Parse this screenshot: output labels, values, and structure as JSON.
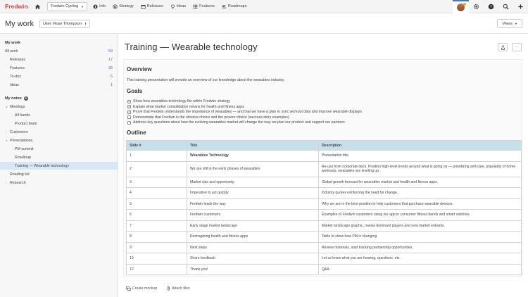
{
  "app": {
    "logo": "Fredwin"
  },
  "topnav": {
    "workspace": "Fredwin Cycling",
    "tabs": [
      {
        "label": "Info",
        "icon": "info-icon"
      },
      {
        "label": "Strategy",
        "icon": "strategy-icon"
      },
      {
        "label": "Releases",
        "icon": "calendar-icon"
      },
      {
        "label": "Ideas",
        "icon": "lightbulb-icon"
      },
      {
        "label": "Features",
        "icon": "grid-icon"
      },
      {
        "label": "Roadmaps",
        "icon": "roadmap-icon"
      }
    ]
  },
  "header": {
    "title": "My work",
    "user_select": "User: Rose Thompson",
    "views": "Views"
  },
  "sidebar": {
    "my_work_heading": "My work",
    "items": [
      {
        "label": "All work",
        "count": "59"
      },
      {
        "label": "Releases",
        "count": "17"
      },
      {
        "label": "Features",
        "count": "36"
      },
      {
        "label": "To-dos",
        "count": "5"
      },
      {
        "label": "Ideas",
        "count": "1"
      }
    ],
    "my_notes_heading": "My notes",
    "notes": {
      "meetings": "Meetings",
      "all_hands": "All hands",
      "product_team": "Product team",
      "customers": "Customers",
      "presentations": "Presentations",
      "pm_summit": "PM summit",
      "roadmap": "Roadmap",
      "training": "Training — Wearable technology",
      "reading_list": "Reading list",
      "research": "Research"
    }
  },
  "note": {
    "title": "Training — Wearable technology",
    "overview_heading": "Overview",
    "overview_text": "This training presentation will provide an overview of our knowledge about the wearables industry.",
    "goals_heading": "Goals",
    "goals": [
      {
        "text": "Show how wearables technology fits within Fredwin strategy",
        "checked": true
      },
      {
        "text": "Explain what market consolidation means for health and fitness apps",
        "checked": true
      },
      {
        "text": "Prove that Fredwin understands the importance of wearables — and that we have a plan to sync workout data and improve wearable displays",
        "checked": true
      },
      {
        "text": "Demonstrate that Fredwin is the obvious choice and the proven choice (success story examples)",
        "checked": false
      },
      {
        "text": "Address key questions about how the evolving wearables market will change the way we plan our product and support our partners",
        "checked": false
      }
    ],
    "outline_heading": "Outline",
    "table": {
      "headers": [
        "Slide #",
        "Title",
        "Description"
      ],
      "rows": [
        [
          "1",
          "Wearables Technology",
          "Presentation title"
        ],
        [
          "2",
          "We are still in the early phases of wearables",
          "Re-use from corporate deck. Position high-level trends around what is going on — prioritizing self-care, popularity of home workouts, wearables are leveling up."
        ],
        [
          "3",
          "Market size and opportunity",
          "Global growth forecast for wearables market and health and fitness apps."
        ],
        [
          "4",
          "Imperative to act quickly",
          "Industry quotes reinforcing the need for change."
        ],
        [
          "5",
          "Fredwin leads the way",
          "Why we are in the best position to help customers that purchase wearable devices."
        ],
        [
          "6",
          "Fredwin customers",
          "Examples of Fredwin customers using our app in consumer fitness bands and smart watches."
        ],
        [
          "7",
          "Early stage market landscape",
          "Market landscape graphic, review dominant players and new market entrants."
        ],
        [
          "8",
          "Reimagining health and fitness apps",
          "Table to show how PM is changing"
        ],
        [
          "9",
          "Next steps",
          "Review materials, start tracking partnership opportunities."
        ],
        [
          "10",
          "Share feedback",
          "Let us know what you are hearing, questions, etc."
        ],
        [
          "12",
          "Thank you!",
          "Q&A"
        ]
      ]
    }
  },
  "footer": {
    "create_mockup": "Create mockup",
    "attach_files": "Attach files"
  },
  "colors": {
    "brand": "#e8423f",
    "accent": "#3a78c2",
    "table_header": "#c7dfe9",
    "active_item": "#d9e7f3"
  }
}
